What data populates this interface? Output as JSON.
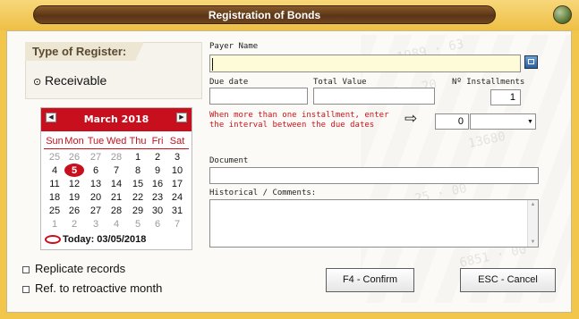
{
  "window": {
    "title": "Registration of Bonds"
  },
  "type_register": {
    "label": "Type of Register:",
    "option": "Receivable"
  },
  "calendar": {
    "month_label": "March 2018",
    "weekdays": [
      "Sun",
      "Mon",
      "Tue",
      "Wed",
      "Thu",
      "Fri",
      "Sat"
    ],
    "weeks": [
      [
        "25",
        "26",
        "27",
        "28",
        "1",
        "2",
        "3"
      ],
      [
        "4",
        "5",
        "6",
        "7",
        "8",
        "9",
        "10"
      ],
      [
        "11",
        "12",
        "13",
        "14",
        "15",
        "16",
        "17"
      ],
      [
        "18",
        "19",
        "20",
        "21",
        "22",
        "23",
        "24"
      ],
      [
        "25",
        "26",
        "27",
        "28",
        "29",
        "30",
        "31"
      ],
      [
        "1",
        "2",
        "3",
        "4",
        "5",
        "6",
        "7"
      ]
    ],
    "selected_day": "5",
    "today_label": "Today: 03/05/2018"
  },
  "options": {
    "replicate_label": "Replicate records",
    "retroactive_label": "Ref. to retroactive month"
  },
  "form": {
    "payer_label": "Payer Name",
    "payer_value": "",
    "due_date_label": "Due date",
    "due_date_value": "",
    "total_value_label": "Total Value",
    "total_value_value": "",
    "installments_label": "Nº Installments",
    "installments_value": "1",
    "interval_note": "When more than one installment, enter the interval between the due dates",
    "interval_value": "0",
    "interval_unit_value": "",
    "document_label": "Document",
    "document_value": "",
    "comments_label": "Historical / Comments:",
    "comments_value": ""
  },
  "buttons": {
    "confirm": "F4 - Confirm",
    "cancel": "ESC - Cancel"
  },
  "colors": {
    "frame": "#f2c54b",
    "title_bar": "#5a3516",
    "calendar_accent": "#c80f1e",
    "note_text": "#d0121b"
  }
}
